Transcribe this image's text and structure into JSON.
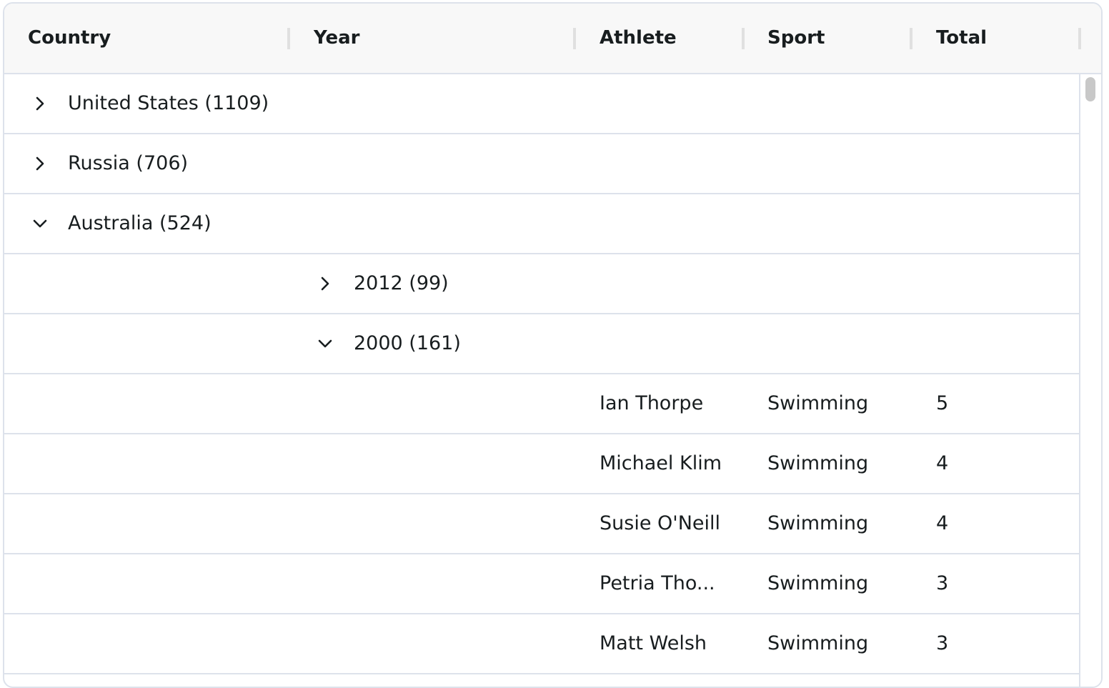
{
  "columns": [
    "Country",
    "Year",
    "Athlete",
    "Sport",
    "Total"
  ],
  "groups": [
    {
      "label": "United States (1109)",
      "expanded": false
    },
    {
      "label": "Russia (706)",
      "expanded": false
    },
    {
      "label": "Australia (524)",
      "expanded": true
    }
  ],
  "subgroups": [
    {
      "label": "2012 (99)",
      "expanded": false
    },
    {
      "label": "2000 (161)",
      "expanded": true
    }
  ],
  "rows": [
    {
      "athlete": "Ian Thorpe",
      "sport": "Swimming",
      "total": "5"
    },
    {
      "athlete": "Michael Klim",
      "sport": "Swimming",
      "total": "4"
    },
    {
      "athlete": "Susie O'Neill",
      "sport": "Swimming",
      "total": "4"
    },
    {
      "athlete": "Petria Tho...",
      "sport": "Swimming",
      "total": "3"
    },
    {
      "athlete": "Matt Welsh",
      "sport": "Swimming",
      "total": "3"
    }
  ],
  "colors": {
    "header_bg": "#f8f8f8",
    "border": "#dde2eb",
    "text": "#181d1f",
    "scroll_thumb": "#c8c8c8"
  }
}
